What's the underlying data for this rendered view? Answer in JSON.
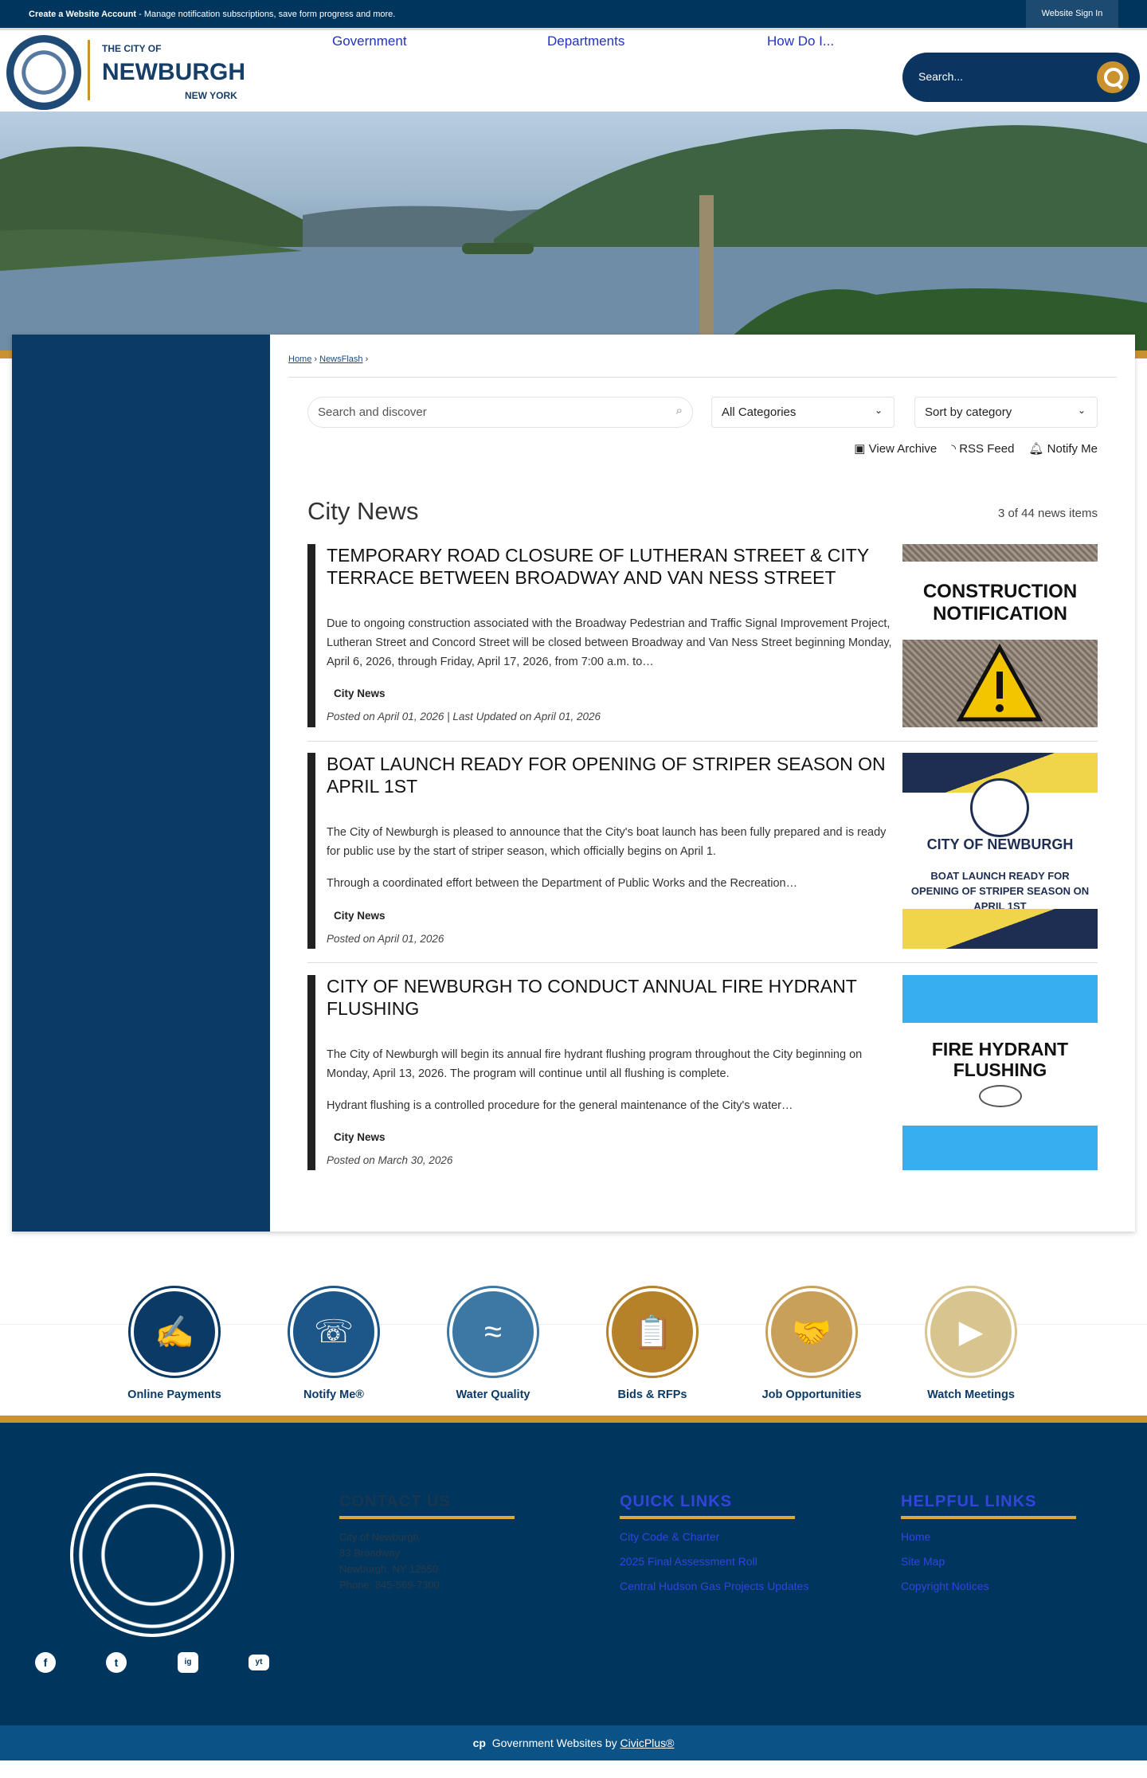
{
  "topbar": {
    "account_link": "Create a Website Account",
    "account_msg": " - Manage notification subscriptions, save form progress and more.",
    "sign_in": "Website Sign In"
  },
  "header": {
    "logo": {
      "line1": "THE CITY OF",
      "line2": "NEWBURGH",
      "line3": "NEW YORK"
    },
    "nav": [
      "Government",
      "Departments",
      "How Do I..."
    ],
    "search_placeholder": "Search..."
  },
  "breadcrumb": [
    "Home",
    "NewsFlash"
  ],
  "filters": {
    "search_placeholder": "Search and discover",
    "category": "All Categories",
    "sort": "Sort by category"
  },
  "actions": {
    "archive": "View Archive",
    "rss": "RSS Feed",
    "notify": "Notify Me"
  },
  "page": {
    "title": "City News",
    "count": "3 of 44 news items"
  },
  "articles": [
    {
      "title": "TEMPORARY ROAD CLOSURE OF LUTHERAN STREET & CITY TERRACE BETWEEN BROADWAY AND VAN NESS STREET",
      "desc": [
        "Due to ongoing construction associated with the Broadway Pedestrian and Traffic Signal Improvement Project, Lutheran Street and Concord Street will be closed between Broadway and Van Ness Street beginning Monday, April 6, 2026, through Friday, April 17, 2026, from 7:00 a.m. to…"
      ],
      "category": "City News",
      "date": "Posted on April 01, 2026 | Last Updated on April 01, 2026",
      "image_text": "CONSTRUCTION NOTIFICATION"
    },
    {
      "title": "BOAT LAUNCH READY FOR OPENING OF STRIPER SEASON ON APRIL 1ST",
      "desc": [
        "The City of Newburgh is pleased to announce that the City's boat launch has been fully prepared and is ready for public use by the start of striper season, which officially begins on April 1.",
        "Through a coordinated effort between the Department of Public Works and the Recreation…"
      ],
      "category": "City News",
      "date": "Posted on April 01, 2026",
      "image_text": "CITY OF NEWBURGH",
      "image_sub": "BOAT LAUNCH READY FOR OPENING OF STRIPER SEASON ON APRIL 1ST"
    },
    {
      "title": "CITY OF NEWBURGH TO CONDUCT ANNUAL FIRE HYDRANT FLUSHING",
      "desc": [
        "The City of Newburgh will begin its annual fire hydrant flushing program throughout the City beginning on Monday, April 13, 2026. The program will continue until all flushing is complete.",
        "Hydrant flushing is a controlled procedure for the general maintenance of the City's water…"
      ],
      "category": "City News",
      "date": "Posted on March 30, 2026",
      "image_text": "FIRE HYDRANT FLUSHING"
    }
  ],
  "quick_icons": [
    {
      "label": "Online Payments",
      "icon": "✍",
      "color": "#0b3a66"
    },
    {
      "label": "Notify Me®",
      "icon": "☏",
      "color": "#1d5688"
    },
    {
      "label": "Water Quality",
      "icon": "≈",
      "color": "#3d77a3"
    },
    {
      "label": "Bids & RFPs",
      "icon": "📋",
      "color": "#b5822a"
    },
    {
      "label": "Job Opportunities",
      "icon": "🤝",
      "color": "#c8a05a"
    },
    {
      "label": "Watch Meetings",
      "icon": "▶",
      "color": "#d8c48e"
    }
  ],
  "footer": {
    "contact": {
      "heading": "CONTACT US",
      "lines": [
        "City of Newburgh",
        "83 Broadway",
        "Newburgh, NY 12550",
        "Phone: 845-569-7300"
      ]
    },
    "quick_links": {
      "heading": "QUICK LINKS",
      "items": [
        "City Code & Charter",
        "2025 Final Assessment Roll",
        "Central Hudson Gas Projects Updates"
      ]
    },
    "helpful_links": {
      "heading": "HELPFUL LINKS",
      "items": [
        "Home",
        "Site Map",
        "Copyright Notices"
      ]
    },
    "social": [
      "f",
      "t",
      "ig",
      "yt"
    ],
    "credit": "Government Websites by ",
    "credit_link": "CivicPlus®"
  }
}
